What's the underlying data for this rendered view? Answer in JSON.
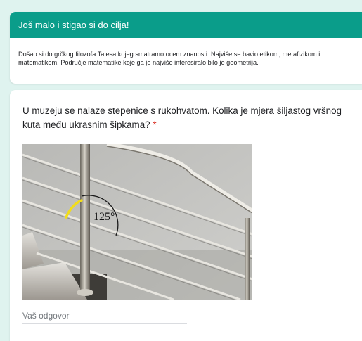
{
  "section": {
    "title": "Još malo i stigao si do cilja!",
    "description": "Došao si do grčkog filozofa Talesa kojeg smatramo ocem znanosti. Najviše se bavio etikom, metafizikom i matematikom. Područje matematike koje ga je najviše interesiralo bilo je geometrija."
  },
  "question": {
    "text": "U muzeju se nalaze stepenice s rukohvatom. Kolika je mjera šiljastog vršnog kuta među ukrasnim šipkama?",
    "required_mark": "*",
    "image": {
      "angle_label": "125°"
    },
    "answer_placeholder": "Vaš odgovor"
  },
  "colors": {
    "header_bg": "#0a9d8a",
    "page_bg": "#dff3ef",
    "required": "#d93025",
    "angle_marker": "#f2dd1a"
  }
}
